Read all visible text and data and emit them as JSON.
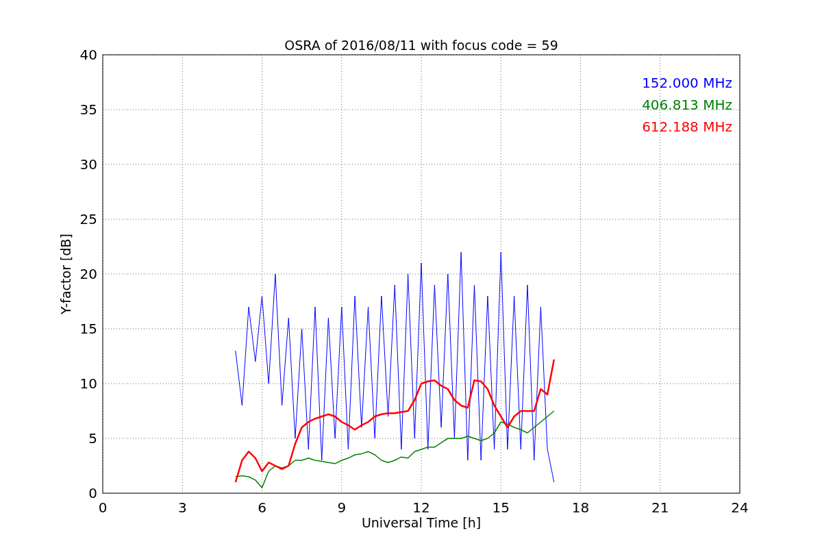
{
  "chart_data": {
    "type": "line",
    "title": "OSRA of 2016/08/11 with focus code = 59",
    "xlabel": "Universal Time [h]",
    "ylabel": "Y-factor [dB]",
    "grid": true,
    "xlim": [
      0,
      24
    ],
    "ylim": [
      0,
      40
    ],
    "xticks": [
      0,
      3,
      6,
      9,
      12,
      15,
      18,
      21,
      24
    ],
    "yticks": [
      0,
      5,
      10,
      15,
      20,
      25,
      30,
      35,
      40
    ],
    "x": [
      5,
      5.25,
      5.5,
      5.75,
      6,
      6.25,
      6.5,
      6.75,
      7,
      7.25,
      7.5,
      7.75,
      8,
      8.25,
      8.5,
      8.75,
      9,
      9.25,
      9.5,
      9.75,
      10,
      10.25,
      10.5,
      10.75,
      11,
      11.25,
      11.5,
      11.75,
      12,
      12.25,
      12.5,
      12.75,
      13,
      13.25,
      13.5,
      13.75,
      14,
      14.25,
      14.5,
      14.75,
      15,
      15.25,
      15.5,
      15.75,
      16,
      16.25,
      16.5,
      16.75,
      17
    ],
    "series": [
      {
        "name": "152.000 MHz",
        "color": "#0000ff",
        "values": [
          13,
          8,
          17,
          12,
          18,
          10,
          20,
          8,
          16,
          5,
          15,
          4,
          17,
          3,
          16,
          5,
          17,
          4,
          18,
          6,
          17,
          5,
          18,
          7,
          19,
          4,
          20,
          5,
          21,
          4,
          19,
          6,
          20,
          5,
          22,
          3,
          19,
          3,
          18,
          4,
          22,
          4,
          18,
          4,
          19,
          3,
          17,
          4,
          1
        ]
      },
      {
        "name": "406.813 MHz",
        "color": "#008000",
        "values": [
          1.5,
          1.6,
          1.5,
          1.2,
          0.5,
          2,
          2.5,
          2.3,
          2.5,
          3,
          3,
          3.2,
          3,
          2.9,
          2.8,
          2.7,
          3,
          3.2,
          3.5,
          3.6,
          3.8,
          3.5,
          3,
          2.8,
          3,
          3.3,
          3.2,
          3.8,
          4,
          4.2,
          4.2,
          4.6,
          5,
          5,
          5,
          5.2,
          5,
          4.8,
          5,
          5.5,
          6.5,
          6.3,
          6,
          5.8,
          5.5,
          6,
          6.5,
          7,
          7.5
        ]
      },
      {
        "name": "612.188 MHz",
        "color": "#ff0000",
        "values": [
          1,
          3,
          3.8,
          3.2,
          2,
          2.8,
          2.5,
          2.2,
          2.5,
          4.5,
          6,
          6.5,
          6.8,
          7,
          7.2,
          7,
          6.5,
          6.2,
          5.8,
          6.2,
          6.5,
          7,
          7.2,
          7.3,
          7.3,
          7.4,
          7.5,
          8.5,
          10,
          10.2,
          10.3,
          9.8,
          9.5,
          8.5,
          8,
          7.8,
          10.3,
          10.2,
          9.5,
          8,
          7,
          6,
          7,
          7.5,
          7.5,
          7.5,
          9.5,
          9,
          12.2
        ]
      }
    ]
  }
}
